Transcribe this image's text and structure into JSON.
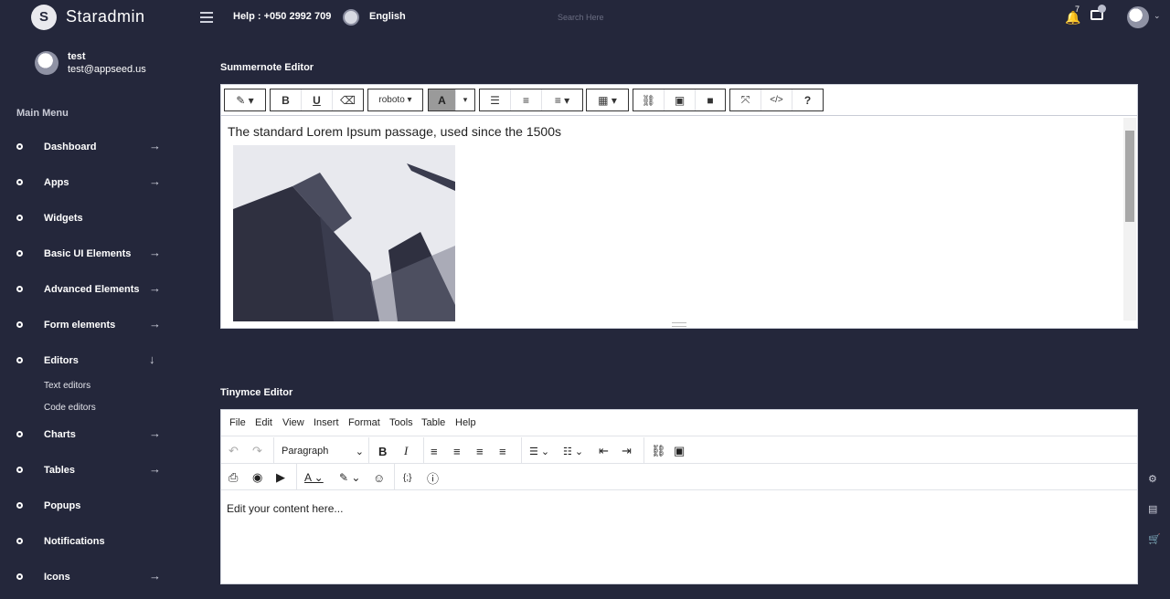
{
  "brand": {
    "name": "Staradmin",
    "logo_letter": "S"
  },
  "topbar": {
    "help": "Help : +050 2992 709",
    "language": "English",
    "search_placeholder": "Search Here",
    "notifications_count": "7"
  },
  "profile": {
    "name": "test",
    "email": "test@appseed.us"
  },
  "sidebar": {
    "title": "Main Menu",
    "items": [
      {
        "label": "Dashboard",
        "arrow": "→"
      },
      {
        "label": "Apps",
        "arrow": "→"
      },
      {
        "label": "Widgets",
        "arrow": ""
      },
      {
        "label": "Basic UI Elements",
        "arrow": "→"
      },
      {
        "label": "Advanced Elements",
        "arrow": "→"
      },
      {
        "label": "Form elements",
        "arrow": "→"
      },
      {
        "label": "Editors",
        "arrow": "↓"
      },
      {
        "label": "Charts",
        "arrow": "→"
      },
      {
        "label": "Tables",
        "arrow": "→"
      },
      {
        "label": "Popups",
        "arrow": ""
      },
      {
        "label": "Notifications",
        "arrow": ""
      },
      {
        "label": "Icons",
        "arrow": "→"
      }
    ],
    "editors_sub": [
      "Text editors",
      "Code editors"
    ]
  },
  "summernote": {
    "title": "Summernote Editor",
    "font_label": "roboto",
    "content_text": "The standard Lorem Ipsum passage, used since the 1500s"
  },
  "tinymce": {
    "title": "Tinymce Editor",
    "menus": [
      "File",
      "Edit",
      "View",
      "Insert",
      "Format",
      "Tools",
      "Table",
      "Help"
    ],
    "block_format": "Paragraph",
    "content_text": "Edit your content here..."
  }
}
